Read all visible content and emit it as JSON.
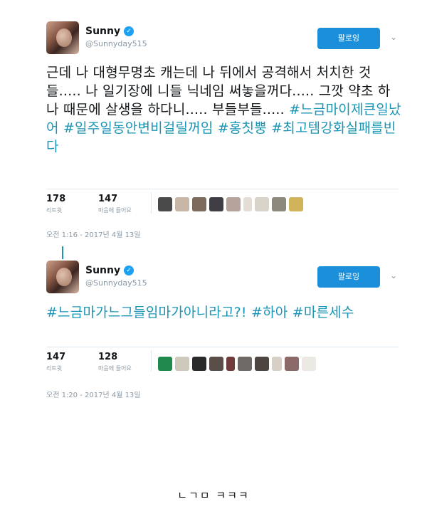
{
  "tweets": [
    {
      "name": "Sunny",
      "handle": "@Sunnyday515",
      "follow_label": "팔로잉",
      "text_plain": "근데 나 대형무명초 캐는데 나 뒤에서 공격해서 처치한 것들..... 나 일기장에 니들 닉네임 써놓을꺼다..... 그깟 약초 하나 때문에 살생을 하다니..... 부들부들..... ",
      "text_hashtags": "#느금마이제큰일났어 #일주일동안변비걸릴꺼임 #홍칫뿡 #최고템강화실패를빈다",
      "retweets": "178",
      "retweets_label": "리트윗",
      "likes": "147",
      "likes_label": "마음에 들어요",
      "timestamp": "오전 1:16 - 2017년 4월 13일"
    },
    {
      "name": "Sunny",
      "handle": "@Sunnyday515",
      "follow_label": "팔로잉",
      "text_plain": "",
      "text_hashtags": "#느금마가느그들임마가아니라고?! #하아 #마른세수",
      "retweets": "147",
      "retweets_label": "리트윗",
      "likes": "128",
      "likes_label": "마음에 들어요",
      "timestamp": "오전 1:20 - 2017년 4월 13일"
    }
  ],
  "caption": "ㄴㄱㅁ ㅋㅋㅋ",
  "colors": {
    "hashtag": "#1b95b5",
    "follow_button": "#1b8fd9",
    "verified": "#1da1f2"
  },
  "icons": {
    "verified": "verified-badge-icon",
    "menu": "chevron-down-icon"
  }
}
